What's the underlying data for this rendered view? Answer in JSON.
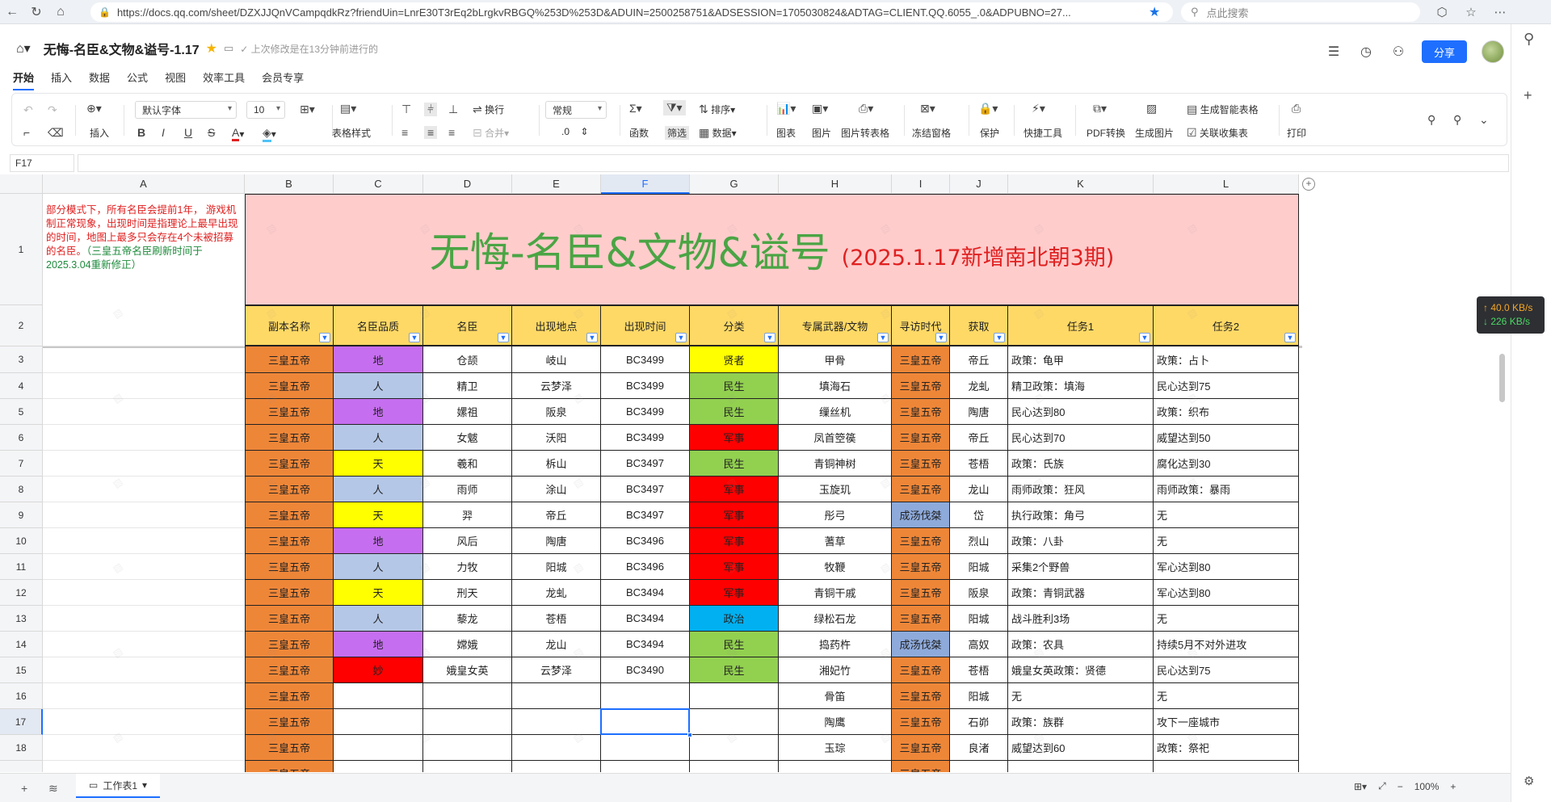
{
  "browser": {
    "url": "https://docs.qq.com/sheet/DZXJJQnVCampqdkRz?friendUin=LnrE30T3rEq2bLrgkvRBGQ%253D%253D&ADUIN=2500258751&ADSESSION=1705030824&ADTAG=CLIENT.QQ.6055_.0&ADPUBNO=27...",
    "search_placeholder": "点此搜索"
  },
  "doc": {
    "title": "无悔-名臣&文物&谥号-1.17",
    "status": "上次修改是在13分钟前进行的",
    "menus": [
      "开始",
      "插入",
      "数据",
      "公式",
      "视图",
      "效率工具",
      "会员专享"
    ],
    "share_label": "分享"
  },
  "toolbar": {
    "insert": "插入",
    "font": "默认字体",
    "size": "10",
    "table_style": "表格样式",
    "wrap": "换行",
    "merge": "合并",
    "number_format": "常规",
    "decimal": ".0",
    "func": "函数",
    "filter": "筛选",
    "sort": "排序",
    "data": "数据",
    "chart": "图表",
    "image": "图片",
    "img2table": "图片转表格",
    "freeze": "冻结窗格",
    "protect": "保护",
    "quick": "快捷工具",
    "pdf": "PDF转换",
    "gen_image": "生成图片",
    "smart_table": "生成智能表格",
    "link_form": "关联收集表",
    "print": "打印"
  },
  "formula": {
    "cell_ref": "F17",
    "content": ""
  },
  "grid": {
    "columns": [
      "A",
      "B",
      "C",
      "D",
      "E",
      "F",
      "G",
      "H",
      "I",
      "J",
      "K",
      "L"
    ],
    "selected_column": "F",
    "selected_row": "17",
    "row_numbers": [
      "1",
      "2",
      "3",
      "4",
      "5",
      "6",
      "7",
      "8",
      "9",
      "10",
      "11",
      "12",
      "13",
      "14",
      "15",
      "16",
      "17",
      "18",
      ""
    ],
    "note_red": "部分模式下，所有名臣会提前1年， 游戏机制正常现象，出现时间是指理论上最早出现的时间，地图上最多只会存在4个未被招募的名臣。",
    "note_green": "（三皇五帝名臣刷新时间于2025.3.04重新修正）",
    "title_main": "无悔-名臣&文物&谥号",
    "title_sub": "(2025.1.17新增南北朝3期)",
    "headers": [
      "副本名称",
      "名臣品质",
      "名臣",
      "出现地点",
      "出现时间",
      "分类",
      "专属武器/文物",
      "寻访时代",
      "获取",
      "任务1",
      "任务2"
    ],
    "rows": [
      [
        "三皇五帝",
        "地",
        "仓颉",
        "岐山",
        "BC3499",
        "贤者",
        "甲骨",
        "三皇五帝",
        "帝丘",
        "政策：龟甲",
        "政策：占卜"
      ],
      [
        "三皇五帝",
        "人",
        "精卫",
        "云梦泽",
        "BC3499",
        "民生",
        "填海石",
        "三皇五帝",
        "龙虬",
        "精卫政策：填海",
        "民心达到75"
      ],
      [
        "三皇五帝",
        "地",
        "嫘祖",
        "阪泉",
        "BC3499",
        "民生",
        "缫丝机",
        "三皇五帝",
        "陶唐",
        "民心达到80",
        "政策：织布"
      ],
      [
        "三皇五帝",
        "人",
        "女魃",
        "沃阳",
        "BC3499",
        "军事",
        "凤首箜篌",
        "三皇五帝",
        "帝丘",
        "民心达到70",
        "威望达到50"
      ],
      [
        "三皇五帝",
        "天",
        "羲和",
        "柝山",
        "BC3497",
        "民生",
        "青铜神树",
        "三皇五帝",
        "苍梧",
        "政策：氏族",
        "腐化达到30"
      ],
      [
        "三皇五帝",
        "人",
        "雨师",
        "涂山",
        "BC3497",
        "军事",
        "玉旋玑",
        "三皇五帝",
        "龙山",
        "雨师政策：狂风",
        "雨师政策：暴雨"
      ],
      [
        "三皇五帝",
        "天",
        "羿",
        "帝丘",
        "BC3497",
        "军事",
        "彤弓",
        "成汤伐桀",
        "岱",
        "执行政策：角弓",
        "无"
      ],
      [
        "三皇五帝",
        "地",
        "风后",
        "陶唐",
        "BC3496",
        "军事",
        "蓍草",
        "三皇五帝",
        "烈山",
        "政策：八卦",
        "无"
      ],
      [
        "三皇五帝",
        "人",
        "力牧",
        "阳城",
        "BC3496",
        "军事",
        "牧鞭",
        "三皇五帝",
        "阳城",
        "采集2个野兽",
        "军心达到80"
      ],
      [
        "三皇五帝",
        "天",
        "刑天",
        "龙虬",
        "BC3494",
        "军事",
        "青铜干戚",
        "三皇五帝",
        "阪泉",
        "政策：青铜武器",
        "军心达到80"
      ],
      [
        "三皇五帝",
        "人",
        "藜龙",
        "苍梧",
        "BC3494",
        "政治",
        "绿松石龙",
        "三皇五帝",
        "阳城",
        "战斗胜利3场",
        "无"
      ],
      [
        "三皇五帝",
        "地",
        "嫦娥",
        "龙山",
        "BC3494",
        "民生",
        "捣药杵",
        "成汤伐桀",
        "高奴",
        "政策：农具",
        "持续5月不对外进攻"
      ],
      [
        "三皇五帝",
        "妙",
        "娥皇女英",
        "云梦泽",
        "BC3490",
        "民生",
        "湘妃竹",
        "三皇五帝",
        "苍梧",
        "娥皇女英政策：贤德",
        "民心达到75"
      ],
      [
        "三皇五帝",
        "",
        "",
        "",
        "",
        "",
        "骨笛",
        "三皇五帝",
        "阳城",
        "无",
        "无"
      ],
      [
        "三皇五帝",
        "",
        "",
        "",
        "",
        "",
        "陶鹰",
        "三皇五帝",
        "石峁",
        "政策：族群",
        "攻下一座城市"
      ],
      [
        "三皇五帝",
        "",
        "",
        "",
        "",
        "",
        "玉琮",
        "三皇五帝",
        "良渚",
        "威望达到60",
        "政策：祭祀"
      ],
      [
        "三皇五帝",
        "",
        "",
        "",
        "",
        "",
        "",
        "三皇五帝",
        "",
        "",
        ""
      ]
    ]
  },
  "colors": {
    "orange": "#ee8638",
    "purple": "#c66ef0",
    "lavender": "#b4c7e7",
    "yellow": "#ffff00",
    "red": "#ff0000",
    "green": "#92d050",
    "blue": "#00b0f0",
    "header": "#ffd966",
    "accent": "#1e6fff"
  },
  "quality_colors": {
    "地": "#c66ef0",
    "人": "#b4c7e7",
    "天": "#ffff00",
    "妙": "#ff0000"
  },
  "category_colors": {
    "贤者": "#ffff00",
    "民生": "#92d050",
    "军事": "#ff0000",
    "政治": "#00b0f0"
  },
  "era_colors": {
    "三皇五帝": "#ee8638",
    "成汤伐桀": "#8eaadb"
  },
  "network": {
    "up": "↑ 40.0 KB/s",
    "down": "↓ 226 KB/s"
  },
  "bottom": {
    "sheet_name": "工作表1",
    "zoom": "100%"
  }
}
